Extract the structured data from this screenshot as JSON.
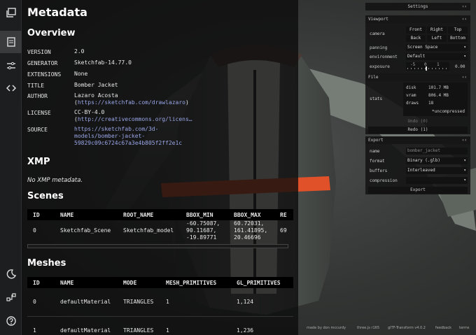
{
  "rail": {
    "icons": [
      "image-stack-icon",
      "document-icon",
      "sliders-icon",
      "code-icon",
      "moon-icon",
      "network-icon",
      "help-icon"
    ]
  },
  "metadata": {
    "title": "Metadata",
    "overview": {
      "heading": "Overview",
      "rows": [
        {
          "key": "VERSION",
          "value": "2.0"
        },
        {
          "key": "GENERATOR",
          "value": "Sketchfab-14.77.0"
        },
        {
          "key": "EXTENSIONS",
          "value": "None"
        },
        {
          "key": "TITLE",
          "value": "Bomber Jacket"
        },
        {
          "key": "AUTHOR",
          "value": "Lazaro Acosta",
          "link": "https://sketchfab.com/drawlazaro"
        },
        {
          "key": "LICENSE",
          "value": "CC-BY-4.0",
          "link": "http://creativecommons.org/licens…"
        },
        {
          "key": "SOURCE",
          "link_lines": [
            "https://sketchfab.com/3d-",
            "models/bomber-jacket-",
            "59829c09c6724c67a3e4b805f2ff2e1c"
          ]
        }
      ]
    },
    "xmp": {
      "heading": "XMP",
      "note": "No XMP metadata."
    },
    "scenes": {
      "heading": "Scenes",
      "columns": [
        "ID",
        "NAME",
        "ROOT_NAME",
        "BBOX_MIN",
        "BBOX_MAX",
        "RE"
      ],
      "rows": [
        {
          "id": "0",
          "name": "Sketchfab_Scene",
          "root_name": "Sketchfab_model",
          "bbox_min": [
            "-60.75087,",
            "90.11687,",
            "-19.89771"
          ],
          "bbox_max": [
            "60.72031,",
            "161.41895,",
            "20.46696"
          ],
          "re": "69"
        }
      ]
    },
    "meshes": {
      "heading": "Meshes",
      "columns": [
        "ID",
        "NAME",
        "MODE",
        "MESH_PRIMITIVES",
        "GL_PRIMITIVES"
      ],
      "rows": [
        {
          "id": "0",
          "name": "defaultMaterial",
          "mode": "TRIANGLES",
          "mesh_primitives": "1",
          "gl_primitives": "1,124"
        },
        {
          "id": "1",
          "name": "defaultMaterial",
          "mode": "TRIANGLES",
          "mesh_primitives": "1",
          "gl_primitives": "1,236"
        }
      ]
    }
  },
  "controls": {
    "settings_label": "Settings",
    "viewport": {
      "label": "Viewport",
      "camera_label": "camera",
      "camera_buttons": [
        "Front",
        "Right",
        "Top",
        "Back",
        "Left",
        "Bottom"
      ],
      "panning_label": "panning",
      "panning_value": "Screen Space",
      "environment_label": "environment",
      "environment_value": "Default",
      "exposure_label": "exposure",
      "exposure_ticks": [
        "-5",
        "0",
        "1"
      ],
      "exposure_value": "0.00"
    },
    "file": {
      "label": "File",
      "stats_label": "stats",
      "stats": [
        {
          "k": "disk",
          "v": "101.7 MB"
        },
        {
          "k": "vram",
          "v": "806.4 MB"
        },
        {
          "k": "draws",
          "v": "18"
        }
      ],
      "stats_note": "*uncompressed",
      "undo_label": "Undo (0)",
      "redo_label": "Redo (1)"
    },
    "export": {
      "label": "Export",
      "name_label": "name",
      "name_placeholder": "bomber_jacket",
      "format_label": "format",
      "format_value": "Binary (.glb)",
      "buffers_label": "buffers",
      "buffers_value": "Interleaved",
      "compression_label": "compression",
      "compression_value": "",
      "export_button": "Export"
    },
    "chevron": "‹‹"
  },
  "footer": {
    "items": [
      "made by don mccurdy",
      "three.js r165",
      "glTF-Transform v4.0.2",
      "feedback",
      "terms"
    ]
  },
  "colors": {
    "link": "#9aa6e8",
    "panel_bg": "#0c0c0c",
    "jacket": "#4a4f4b",
    "band": "#e0512a"
  }
}
